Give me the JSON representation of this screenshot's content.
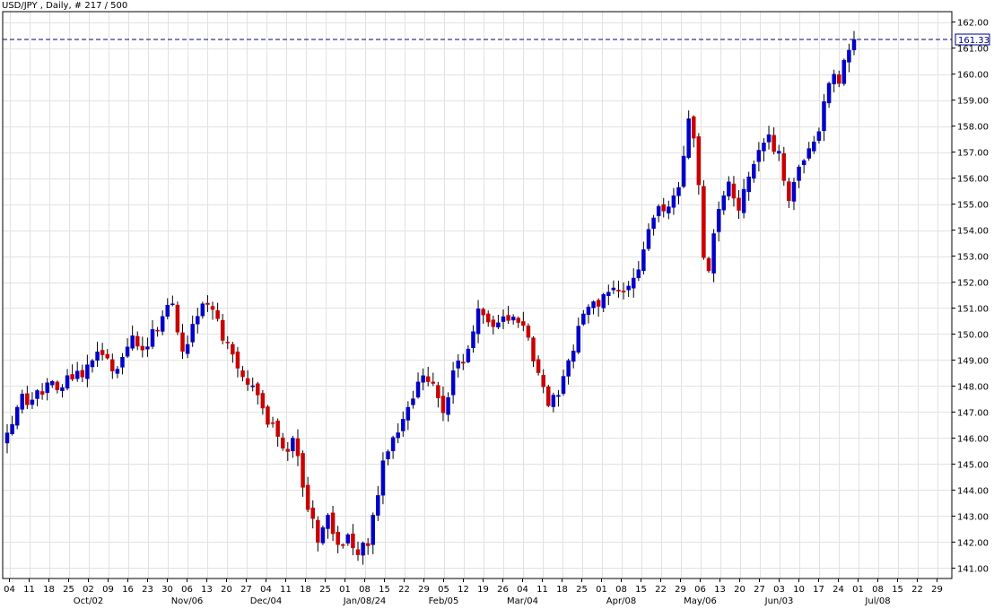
{
  "header": {
    "title": "USD/JPY , Daily, # 217 / 500"
  },
  "last_price_label": "161.33",
  "colors": {
    "up": "#0000c8",
    "down": "#c80000",
    "grid": "#e2e2e2",
    "price_line": "#000080"
  },
  "chart_data": {
    "type": "candlestick",
    "title": "USD/JPY , Daily, # 217 / 500",
    "ylim": [
      140.6,
      162.4
    ],
    "y_ticks": [
      "141.00",
      "142.00",
      "143.00",
      "144.00",
      "145.00",
      "146.00",
      "147.00",
      "148.00",
      "149.00",
      "150.00",
      "151.00",
      "152.00",
      "153.00",
      "154.00",
      "155.00",
      "156.00",
      "157.00",
      "158.00",
      "159.00",
      "160.00",
      "161.00",
      "162.00"
    ],
    "x_day_labels": [
      "04",
      "11",
      "18",
      "25",
      "02",
      "09",
      "16",
      "23",
      "30",
      "06",
      "13",
      "20",
      "27",
      "04",
      "11",
      "18",
      "25",
      "01",
      "08",
      "15",
      "22",
      "29",
      "05",
      "12",
      "19",
      "26",
      "04",
      "11",
      "18",
      "25",
      "01",
      "08",
      "15",
      "22",
      "29",
      "06",
      "13",
      "20",
      "27",
      "03",
      "10",
      "17",
      "24",
      "01",
      "08",
      "15",
      "22",
      "29"
    ],
    "x_month_labels": [
      {
        "label": "Oct/02",
        "week": 4
      },
      {
        "label": "Nov/06",
        "week": 9
      },
      {
        "label": "Dec/04",
        "week": 13
      },
      {
        "label": "Jan/08/24",
        "week": 18
      },
      {
        "label": "Feb/05",
        "week": 22
      },
      {
        "label": "Mar/04",
        "week": 26
      },
      {
        "label": "Apr/08",
        "week": 31
      },
      {
        "label": "May/06",
        "week": 35
      },
      {
        "label": "Jun/03",
        "week": 39
      },
      {
        "label": "Jul/08",
        "week": 44
      }
    ],
    "grid": true,
    "last_price": 161.33,
    "path_points": [
      [
        0,
        146.2
      ],
      [
        3,
        147.6
      ],
      [
        5,
        147.5
      ],
      [
        10,
        148.1
      ],
      [
        15,
        148.6
      ],
      [
        18,
        149.2
      ],
      [
        22,
        148.6
      ],
      [
        25,
        149.7
      ],
      [
        27,
        149.3
      ],
      [
        30,
        150.3
      ],
      [
        33,
        151.2
      ],
      [
        35,
        149.4
      ],
      [
        38,
        150.8
      ],
      [
        40,
        151.3
      ],
      [
        43,
        150.0
      ],
      [
        45,
        149.5
      ],
      [
        47,
        148.3
      ],
      [
        50,
        147.8
      ],
      [
        52,
        146.8
      ],
      [
        55,
        145.4
      ],
      [
        57,
        146.1
      ],
      [
        60,
        143.5
      ],
      [
        62,
        142.1
      ],
      [
        64,
        143.0
      ],
      [
        66,
        141.9
      ],
      [
        68,
        142.4
      ],
      [
        70,
        141.4
      ],
      [
        72,
        142.0
      ],
      [
        75,
        145.1
      ],
      [
        78,
        146.2
      ],
      [
        80,
        147.0
      ],
      [
        82,
        148.3
      ],
      [
        85,
        148.0
      ],
      [
        87,
        147.2
      ],
      [
        89,
        148.4
      ],
      [
        92,
        149.4
      ],
      [
        94,
        150.8
      ],
      [
        97,
        150.3
      ],
      [
        100,
        150.7
      ],
      [
        103,
        150.4
      ],
      [
        106,
        148.5
      ],
      [
        108,
        147.2
      ],
      [
        110,
        147.8
      ],
      [
        113,
        149.2
      ],
      [
        115,
        151.0
      ],
      [
        118,
        151.3
      ],
      [
        121,
        151.5
      ],
      [
        124,
        151.6
      ],
      [
        126,
        152.5
      ],
      [
        128,
        154.2
      ],
      [
        130,
        154.7
      ],
      [
        132,
        154.8
      ],
      [
        134,
        155.5
      ],
      [
        136,
        158.3
      ],
      [
        137,
        157.5
      ],
      [
        138,
        155.6
      ],
      [
        139,
        153.2
      ],
      [
        140,
        152.7
      ],
      [
        142,
        154.6
      ],
      [
        144,
        156.1
      ],
      [
        146,
        154.5
      ],
      [
        148,
        156.2
      ],
      [
        150,
        156.9
      ],
      [
        152,
        157.4
      ],
      [
        154,
        156.9
      ],
      [
        156,
        155.2
      ],
      [
        158,
        156.6
      ],
      [
        160,
        157.0
      ],
      [
        162,
        157.9
      ],
      [
        164,
        159.6
      ],
      [
        166,
        159.9
      ],
      [
        167,
        160.8
      ],
      [
        168,
        161.1
      ],
      [
        169,
        161.33
      ]
    ]
  }
}
